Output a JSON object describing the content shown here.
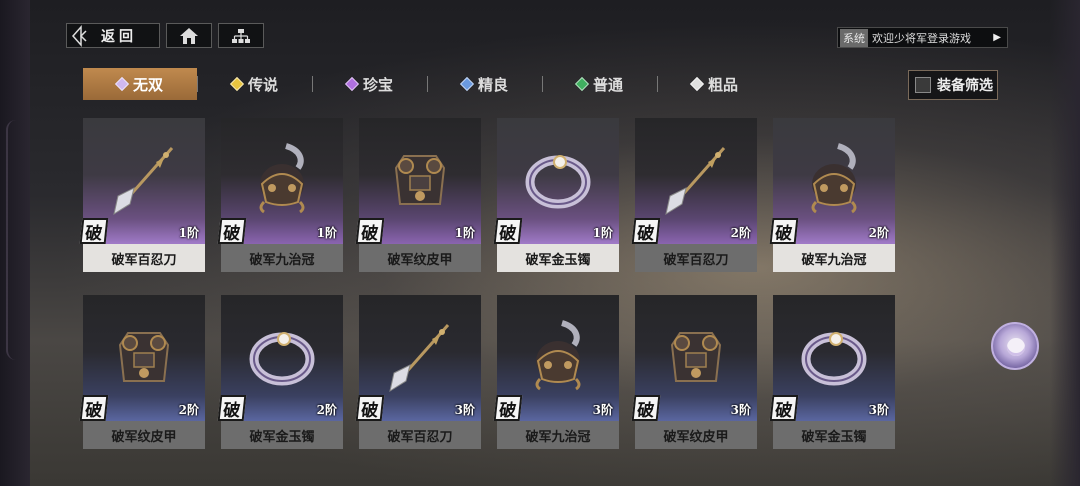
{
  "nav": {
    "back_label": "返回",
    "back_icon": "back-arrow-icon",
    "home_icon": "home-icon",
    "tree_icon": "hierarchy-icon"
  },
  "system_bar": {
    "tag": "系统",
    "message": "欢迎少将军登录游戏",
    "arrow": "▶"
  },
  "tabs": [
    {
      "label": "无双",
      "color": "#d0b8f0",
      "active": true
    },
    {
      "label": "传说",
      "color": "#e8c440",
      "active": false
    },
    {
      "label": "珍宝",
      "color": "#b070e0",
      "active": false
    },
    {
      "label": "精良",
      "color": "#6a9ae0",
      "active": false
    },
    {
      "label": "普通",
      "color": "#40b060",
      "active": false
    },
    {
      "label": "粗品",
      "color": "#e0e0e0",
      "active": false
    }
  ],
  "filter": {
    "label": "装备筛选",
    "checked": false
  },
  "items": [
    {
      "name": "破军百忍刀",
      "tier": "1阶",
      "badge": "破",
      "icon": "glaive-icon",
      "highlighted": true
    },
    {
      "name": "破军九治冠",
      "tier": "1阶",
      "badge": "破",
      "icon": "helmet-icon",
      "highlighted": false
    },
    {
      "name": "破军纹皮甲",
      "tier": "1阶",
      "badge": "破",
      "icon": "armor-icon",
      "highlighted": false
    },
    {
      "name": "破军金玉镯",
      "tier": "1阶",
      "badge": "破",
      "icon": "bracelet-icon",
      "highlighted": true
    },
    {
      "name": "破军百忍刀",
      "tier": "2阶",
      "badge": "破",
      "icon": "glaive-icon",
      "highlighted": false
    },
    {
      "name": "破军九治冠",
      "tier": "2阶",
      "badge": "破",
      "icon": "helmet-icon",
      "highlighted": true
    },
    {
      "name": "破军纹皮甲",
      "tier": "2阶",
      "badge": "破",
      "icon": "armor-icon",
      "highlighted": false
    },
    {
      "name": "破军金玉镯",
      "tier": "2阶",
      "badge": "破",
      "icon": "bracelet-icon",
      "highlighted": false
    },
    {
      "name": "破军百忍刀",
      "tier": "3阶",
      "badge": "破",
      "icon": "glaive-icon",
      "highlighted": false
    },
    {
      "name": "破军九治冠",
      "tier": "3阶",
      "badge": "破",
      "icon": "helmet-icon",
      "highlighted": false
    },
    {
      "name": "破军纹皮甲",
      "tier": "3阶",
      "badge": "破",
      "icon": "armor-icon",
      "highlighted": false
    },
    {
      "name": "破军金玉镯",
      "tier": "3阶",
      "badge": "破",
      "icon": "bracelet-icon",
      "highlighted": false
    }
  ],
  "avatar": {
    "icon": "character-avatar-icon"
  }
}
